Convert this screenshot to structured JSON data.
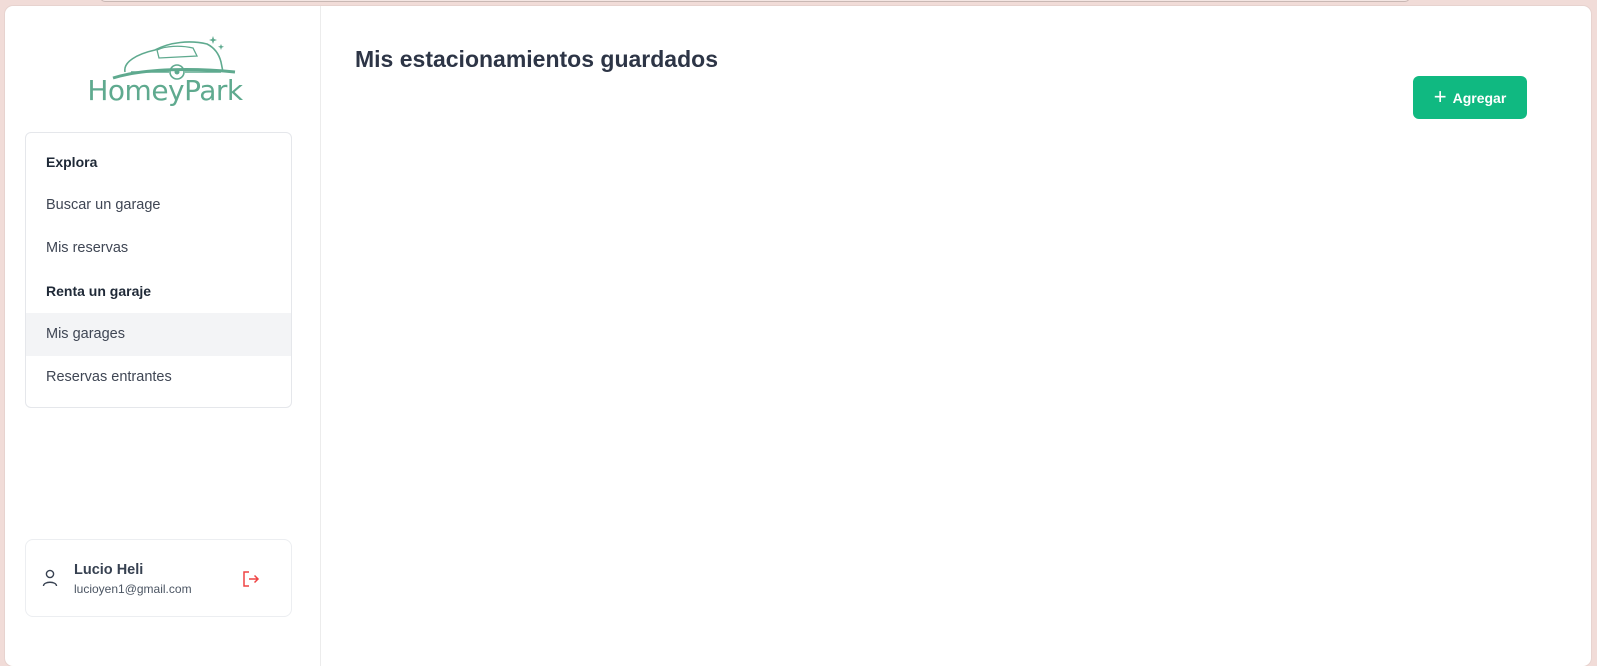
{
  "brand": {
    "name": "HomeyPark",
    "logo_icon": "car-logo-icon",
    "logo_color": "#5faa8f"
  },
  "sidebar": {
    "nav": [
      {
        "label": "Explora",
        "type": "heading"
      },
      {
        "label": "Buscar un garage",
        "type": "link"
      },
      {
        "label": "Mis reservas",
        "type": "link"
      },
      {
        "label": "Renta un garaje",
        "type": "heading"
      },
      {
        "label": "Mis garages",
        "type": "link",
        "active": true
      },
      {
        "label": "Reservas entrantes",
        "type": "link"
      }
    ],
    "user": {
      "name": "Lucio Heli",
      "email": "lucioyen1@gmail.com",
      "icon": "user-icon",
      "logout_icon": "logout-icon",
      "logout_color": "#ef4444"
    }
  },
  "main": {
    "title": "Mis estacionamientos guardados",
    "add_button": {
      "label": "Agregar",
      "icon": "plus-icon",
      "color": "#10b981"
    }
  }
}
